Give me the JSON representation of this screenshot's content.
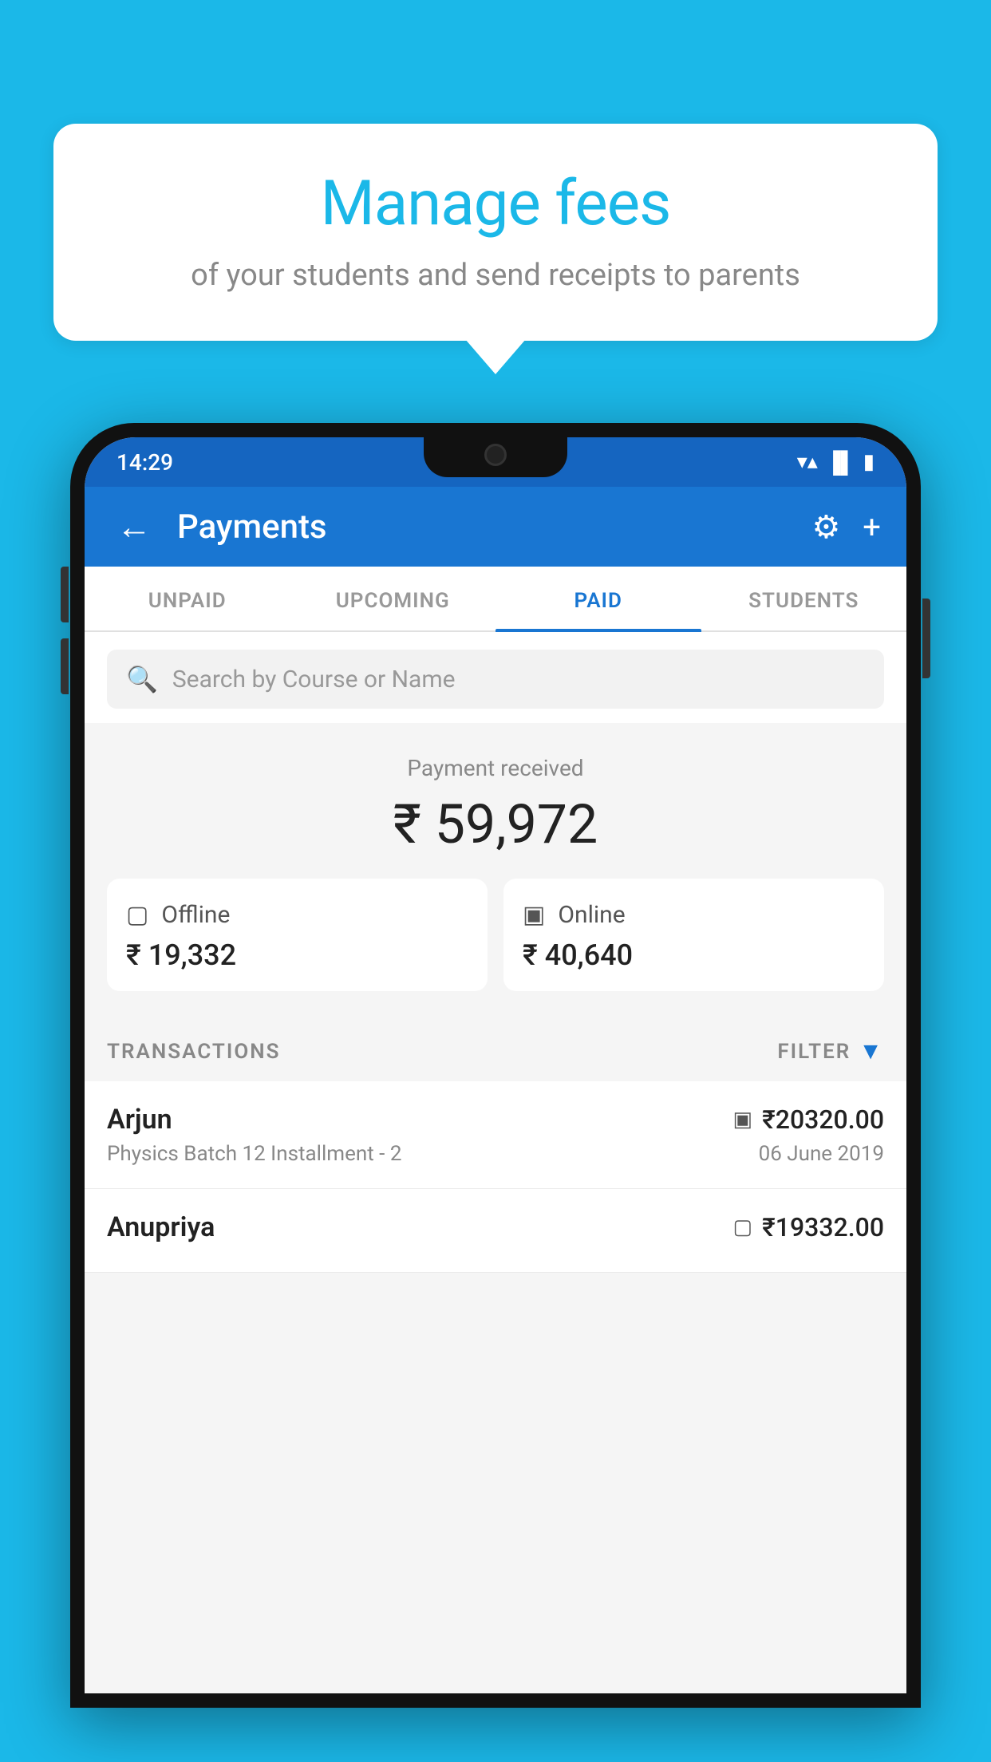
{
  "tooltip": {
    "title": "Manage fees",
    "subtitle": "of your students and send receipts to parents"
  },
  "statusBar": {
    "time": "14:29",
    "wifi": "▲",
    "signal": "▲",
    "battery": "▮"
  },
  "appBar": {
    "title": "Payments",
    "backLabel": "←",
    "settingsLabel": "⚙",
    "addLabel": "+"
  },
  "tabs": [
    {
      "label": "UNPAID",
      "active": false
    },
    {
      "label": "UPCOMING",
      "active": false
    },
    {
      "label": "PAID",
      "active": true
    },
    {
      "label": "STUDENTS",
      "active": false
    }
  ],
  "search": {
    "placeholder": "Search by Course or Name"
  },
  "payment": {
    "receivedLabel": "Payment received",
    "totalAmount": "₹ 59,972",
    "offline": {
      "type": "Offline",
      "amount": "₹ 19,332"
    },
    "online": {
      "type": "Online",
      "amount": "₹ 40,640"
    }
  },
  "transactions": {
    "label": "TRANSACTIONS",
    "filterLabel": "FILTER",
    "rows": [
      {
        "name": "Arjun",
        "amount": "₹20320.00",
        "course": "Physics Batch 12 Installment - 2",
        "date": "06 June 2019",
        "paymentType": "card"
      },
      {
        "name": "Anupriya",
        "amount": "₹19332.00",
        "course": "",
        "date": "",
        "paymentType": "cash"
      }
    ]
  }
}
